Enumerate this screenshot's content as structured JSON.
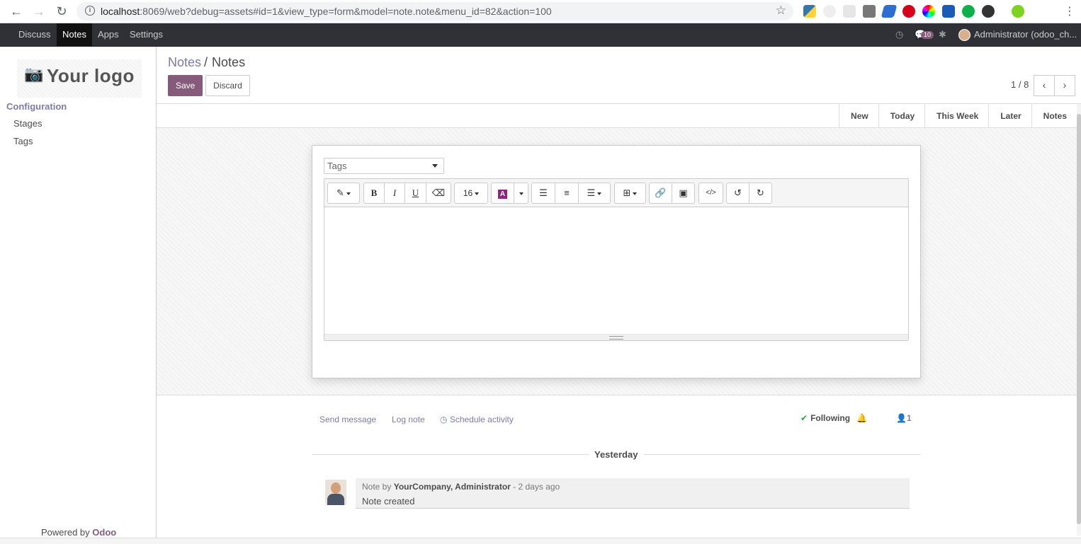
{
  "browser": {
    "url_host": "localhost",
    "url_rest": ":8069/web?debug=assets#id=1&view_type=form&model=note.note&menu_id=82&action=100"
  },
  "navbar": {
    "menu": [
      "Discuss",
      "Notes",
      "Apps",
      "Settings"
    ],
    "active_menu": "Notes",
    "message_count": "10",
    "user_name": "Administrator (odoo_ch..."
  },
  "sidebar": {
    "logo_text": "Your logo",
    "section": "Configuration",
    "items": [
      "Stages",
      "Tags"
    ],
    "powered_by": "Powered by",
    "powered_brand": "Odoo"
  },
  "control_panel": {
    "breadcrumb_parent": "Notes",
    "breadcrumb_separator": "/",
    "breadcrumb_current": "Notes",
    "save_label": "Save",
    "discard_label": "Discard",
    "pager": "1 / 8"
  },
  "statusbar": {
    "stages": [
      "New",
      "Today",
      "This Week",
      "Later",
      "Notes"
    ]
  },
  "form": {
    "tags_placeholder": "Tags",
    "font_size": "16"
  },
  "chatter": {
    "send_message": "Send message",
    "log_note": "Log note",
    "schedule_activity": "Schedule activity",
    "following": "Following",
    "followers_count": "1",
    "date_separator": "Yesterday",
    "message": {
      "prefix": "Note by",
      "author": "YourCompany, Administrator",
      "time": "- 2 days ago",
      "body": "Note created"
    }
  },
  "colors": {
    "brand": "#875a7b",
    "link": "#7c7bad",
    "navbar": "#2f3136"
  }
}
